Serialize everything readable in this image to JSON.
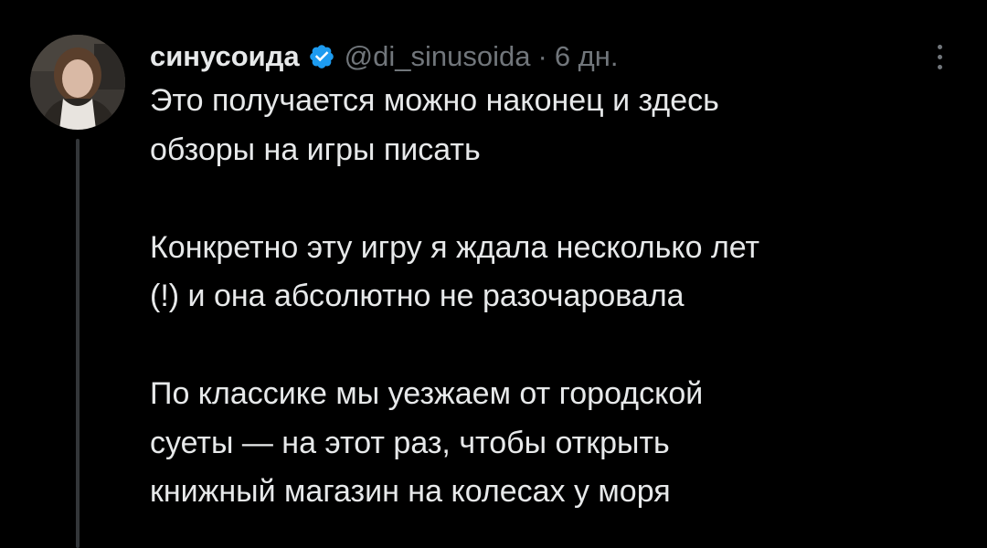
{
  "tweet": {
    "author_name": "синусоида",
    "handle": "@di_sinusoida",
    "separator": "·",
    "time": "6 дн.",
    "paragraphs": [
      [
        "Это получается можно наконец и здесь",
        "обзоры на игры писать"
      ],
      [
        "Конкретно эту игру я ждала несколько лет",
        "(!) и она абсолютно не разочаровала"
      ],
      [
        "По классике мы уезжаем от городской",
        "суеты — на этот раз, чтобы открыть",
        "книжный магазин на колесах у моря"
      ]
    ]
  },
  "icons": {
    "verified": "verified-badge-icon",
    "more": "more-vertical-icon"
  },
  "colors": {
    "background": "#000000",
    "text": "#e7e9ea",
    "muted": "#71767b",
    "verified": "#1d9bf0",
    "thread_line": "#333639"
  }
}
